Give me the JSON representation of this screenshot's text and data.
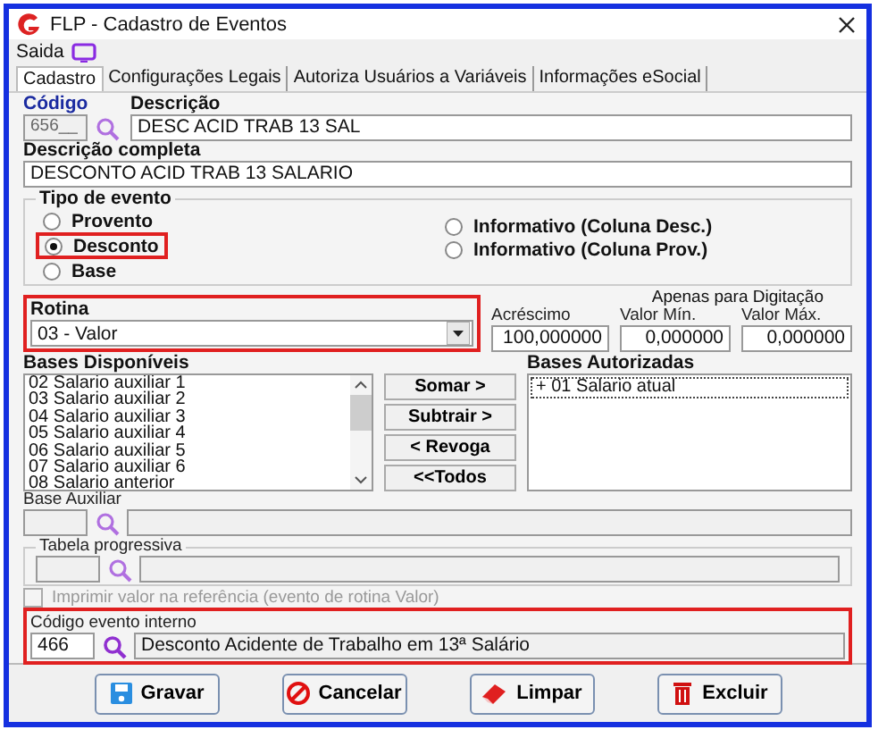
{
  "window": {
    "title": "FLP - Cadastro de Eventos"
  },
  "menu": [
    {
      "label": "Saida"
    }
  ],
  "tabs": [
    {
      "label": "Cadastro",
      "selected": true
    },
    {
      "label": "Configurações Legais",
      "selected": false
    },
    {
      "label": "Autoriza Usuários a Variáveis",
      "selected": false
    },
    {
      "label": "Informações eSocial",
      "selected": false
    }
  ],
  "codigo": {
    "label": "Código",
    "value": "656__"
  },
  "descricao": {
    "label": "Descrição",
    "value": "DESC ACID TRAB 13 SAL"
  },
  "descricao_completa": {
    "label": "Descrição completa",
    "value": "DESCONTO ACID TRAB 13 SALARIO"
  },
  "tipo_evento": {
    "title": "Tipo de evento",
    "options": [
      {
        "label": "Provento",
        "selected": false,
        "highlighted": false
      },
      {
        "label": "Desconto",
        "selected": true,
        "highlighted": true
      },
      {
        "label": "Base",
        "selected": false,
        "highlighted": false
      },
      {
        "label": "Informativo (Coluna Desc.)",
        "selected": false,
        "highlighted": false
      },
      {
        "label": "Informativo (Coluna Prov.)",
        "selected": false,
        "highlighted": false
      }
    ]
  },
  "rotina": {
    "label": "Rotina",
    "value": "03 - Valor",
    "highlighted": true
  },
  "digitacao_note": "Apenas para Digitação",
  "numeric_fields": [
    {
      "label": "Acréscimo",
      "value": "100,000000"
    },
    {
      "label": "Valor Mín.",
      "value": "0,000000"
    },
    {
      "label": "Valor Máx.",
      "value": "0,000000"
    }
  ],
  "bases_disponiveis": {
    "label": "Bases Disponíveis",
    "items": [
      "02 Salario auxiliar 1",
      "03 Salario auxiliar 2",
      "04 Salario auxiliar 3",
      "05 Salario auxiliar 4",
      "06 Salario auxiliar 5",
      "07 Salario auxiliar 6",
      "08 Salario anterior"
    ]
  },
  "transfer_buttons": [
    {
      "label": "Somar >"
    },
    {
      "label": "Subtrair >"
    },
    {
      "label": "< Revoga"
    },
    {
      "label": "<<Todos"
    }
  ],
  "bases_autorizadas": {
    "label": "Bases Autorizadas",
    "items": [
      "+ 01 Salario atual"
    ]
  },
  "base_auxiliar": {
    "label": "Base Auxiliar"
  },
  "tabela_progressiva": {
    "title": "Tabela progressiva"
  },
  "imprimir": {
    "label": "Imprimir valor na referência (evento de rotina Valor)",
    "checked": false,
    "disabled": true
  },
  "codigo_evento_interno": {
    "label": "Código evento interno",
    "code": "466",
    "description": "Desconto Acidente de Trabalho em 13ª Salário",
    "highlighted": true
  },
  "buttons": [
    {
      "label": "Gravar",
      "kind": "save"
    },
    {
      "label": "Cancelar",
      "kind": "cancel"
    },
    {
      "label": "Limpar",
      "kind": "clear"
    },
    {
      "label": "Excluir",
      "kind": "delete"
    }
  ]
}
